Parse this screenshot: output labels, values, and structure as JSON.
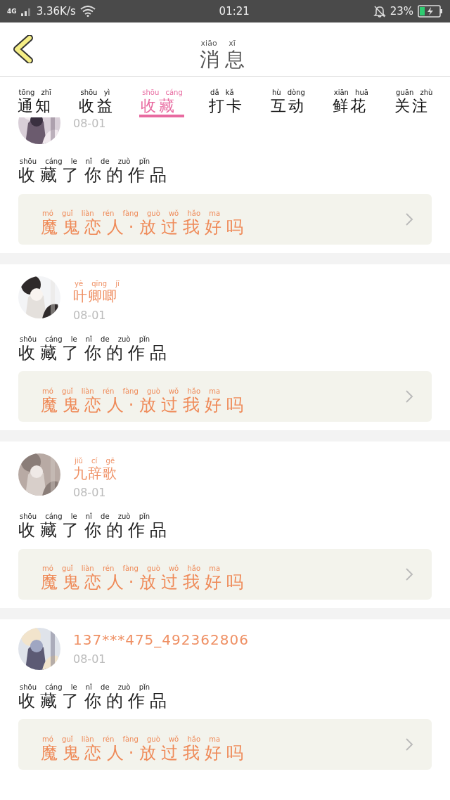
{
  "status_bar": {
    "network": "4G",
    "speed": "3.36K/s",
    "time": "01:21",
    "battery": "23%"
  },
  "header": {
    "title": {
      "text": "消息",
      "pinyin": "xiāo xī"
    }
  },
  "tabs": [
    {
      "text": "通知",
      "pinyin": "tōng zhī",
      "selected": false
    },
    {
      "text": "收益",
      "pinyin": "shōu yì",
      "selected": false
    },
    {
      "text": "收藏",
      "pinyin": "shōu cáng",
      "selected": true
    },
    {
      "text": "打卡",
      "pinyin": "dǎ kǎ",
      "selected": false
    },
    {
      "text": "互动",
      "pinyin": "hù dòng",
      "selected": false
    },
    {
      "text": "鲜花",
      "pinyin": "xiān huā",
      "selected": false
    },
    {
      "text": "关注",
      "pinyin": "guān zhù",
      "selected": false
    }
  ],
  "messages": [
    {
      "date": "08-01",
      "message": {
        "text": "收藏了你的作品",
        "pinyin": "shōu cáng le nǐ de zuò pǐn"
      },
      "work": {
        "text": "魔鬼恋人·放过我好吗",
        "pinyin": "mó guǐ liàn rén fàng guò wǒ hǎo ma"
      }
    },
    {
      "user": {
        "text": "叶卿唧",
        "pinyin": "yè qīng jī"
      },
      "date": "08-01",
      "message": {
        "text": "收藏了你的作品",
        "pinyin": "shōu cáng le nǐ de zuò pǐn"
      },
      "work": {
        "text": "魔鬼恋人·放过我好吗",
        "pinyin": "mó guǐ liàn rén fàng guò wǒ hǎo ma"
      }
    },
    {
      "user": {
        "text": "九辞歌",
        "pinyin": "jiǔ cí gē"
      },
      "date": "08-01",
      "message": {
        "text": "收藏了你的作品",
        "pinyin": "shōu cáng le nǐ de zuò pǐn"
      },
      "work": {
        "text": "魔鬼恋人·放过我好吗",
        "pinyin": "mó guǐ liàn rén fàng guò wǒ hǎo ma"
      }
    },
    {
      "user": {
        "text": "137***475_492362806"
      },
      "date": "08-01",
      "message": {
        "text": "收藏了你的作品",
        "pinyin": "shōu cáng le nǐ de zuò pǐn"
      },
      "work": {
        "text": "魔鬼恋人·放过我好吗",
        "pinyin": "mó guǐ liàn rén fàng guò wǒ hǎo ma"
      }
    }
  ]
}
